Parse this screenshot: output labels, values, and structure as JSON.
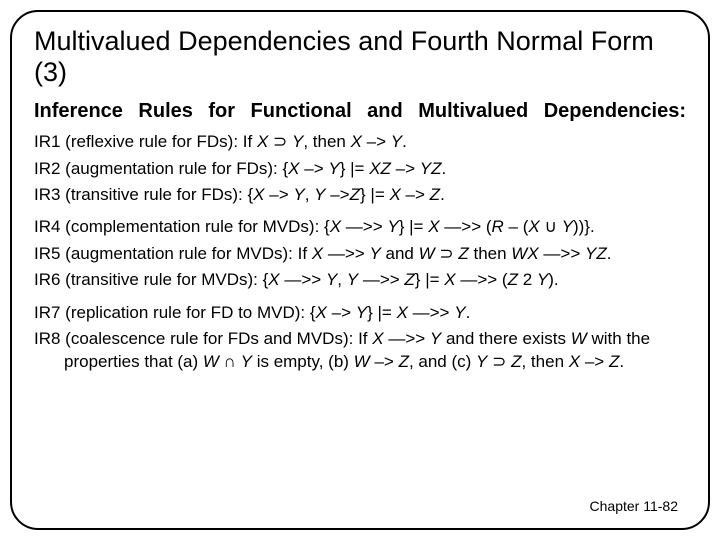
{
  "title": "Multivalued Dependencies and Fourth Normal Form (3)",
  "subhead": "Inference Rules for Functional and Multivalued Dependencies:",
  "rules": {
    "ir1": {
      "label": "IR1 (reflexive rule for FDs):",
      "body_a": " If ",
      "var1": "X",
      "sup": " ⊃ ",
      "var2": "Y",
      "body_b": ", then ",
      "var3": "X",
      "arrow": "  –> ",
      "var4": "Y",
      "end": "."
    },
    "ir2": {
      "label": "IR2 (augmentation rule for FDs):",
      "body_a": " {",
      "var1": "X",
      "arrow1": " –> ",
      "var2": "Y",
      "body_b": "} ",
      "turn": "|=",
      "sp": " ",
      "var3": "XZ",
      "arrow2": " –> ",
      "var4": "YZ",
      "end": "."
    },
    "ir3": {
      "label": "IR3 (transitive rule for FDs):",
      "body_a": " {",
      "var1": "X",
      "arrow1": " –> ",
      "var2": "Y",
      "c1": ", ",
      "var3": "Y",
      "arrow2": " –>",
      "var4": "Z",
      "body_b": "} ",
      "turn": "|=",
      "sp": " ",
      "var5": "X",
      "arrow3": " –> ",
      "var6": "Z",
      "end": "."
    },
    "ir4": {
      "label": "IR4 (complementation rule for MVDs):",
      "body_a": " {",
      "var1": "X",
      "marrow1": " —>> ",
      "var2": "Y",
      "body_b": "} ",
      "turn": "|=",
      "sp": " ",
      "var3": "X",
      "marrow2": " —>> (",
      "var4": "R",
      "minus": " – (",
      "var5": "X",
      "cup": " ∪ ",
      "var6": "Y",
      "end": "))}."
    },
    "ir5": {
      "label": "IR5 (augmentation rule for MVDs):",
      "body_a": " If ",
      "var1": "X",
      "marrow1": " —>> ",
      "var2": "Y",
      "body_b": " and ",
      "var3": "W",
      "sup": " ⊃ ",
      "var4": "Z",
      "body_c": " then ",
      "var5": "WX",
      "marrow2": " —>> ",
      "var6": "YZ",
      "end": "."
    },
    "ir6": {
      "label": "IR6 (transitive rule for MVDs):",
      "body_a": " {",
      "var1": "X",
      "marrow1": " —>> ",
      "var2": "Y",
      "c1": ", ",
      "var3": "Y",
      "marrow2": " —>> ",
      "var4": "Z",
      "body_b": "} ",
      "turn": "|=",
      "sp": " ",
      "var5": "X",
      "marrow3": " —>> (",
      "var6": "Z",
      "minus": " 2 ",
      "var7": "Y",
      "end": ")."
    },
    "ir7": {
      "label": "IR7 (replication rule for FD to MVD):",
      "body_a": " {",
      "var1": "X",
      "arrow1": " –> ",
      "var2": "Y",
      "body_b": "} ",
      "turn": "|=",
      "sp": " ",
      "var3": "X",
      "marrow": " —>> ",
      "var4": "Y",
      "end": "."
    },
    "ir8": {
      "label": "IR8 (coalescence rule for FDs and MVDs):",
      "body_a": " If ",
      "var1": "X",
      "marrow1": " —>> ",
      "var2": "Y",
      "body_b": " and there exists ",
      "var3": "W",
      "body_c": " with the properties that (a) ",
      "var4": "W",
      "cap": " ∩ ",
      "var5": "Y",
      "body_d": " is empty, (b) ",
      "var6": "W",
      "arrow1": " –> ",
      "var7": "Z",
      "body_e": ", and (c) ",
      "var8": "Y",
      "sup": " ⊃ ",
      "var9": "Z",
      "body_f": ", then   ",
      "var10": "X",
      "arrow2": " –> ",
      "var11": "Z",
      "end": "."
    }
  },
  "footer": "Chapter 11-82"
}
